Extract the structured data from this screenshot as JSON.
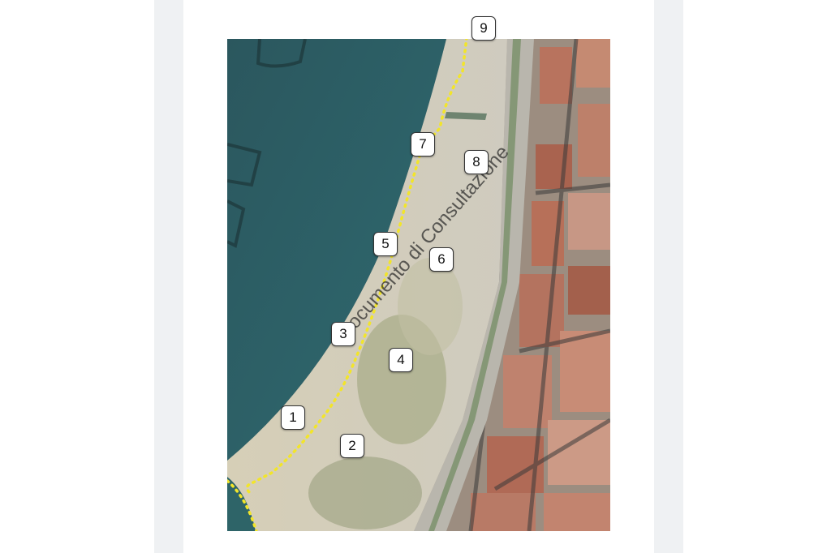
{
  "document": {
    "watermark": "Documento di Consultazione"
  },
  "map": {
    "type": "aerial-orthophoto",
    "boundary_line_color": "#f2e52a",
    "water_color": "#2b5a60",
    "sand_color": "#d9d3bf",
    "markers": [
      {
        "label": "1"
      },
      {
        "label": "2"
      },
      {
        "label": "3"
      },
      {
        "label": "4"
      },
      {
        "label": "5"
      },
      {
        "label": "6"
      },
      {
        "label": "7"
      },
      {
        "label": "8"
      },
      {
        "label": "9"
      }
    ]
  }
}
